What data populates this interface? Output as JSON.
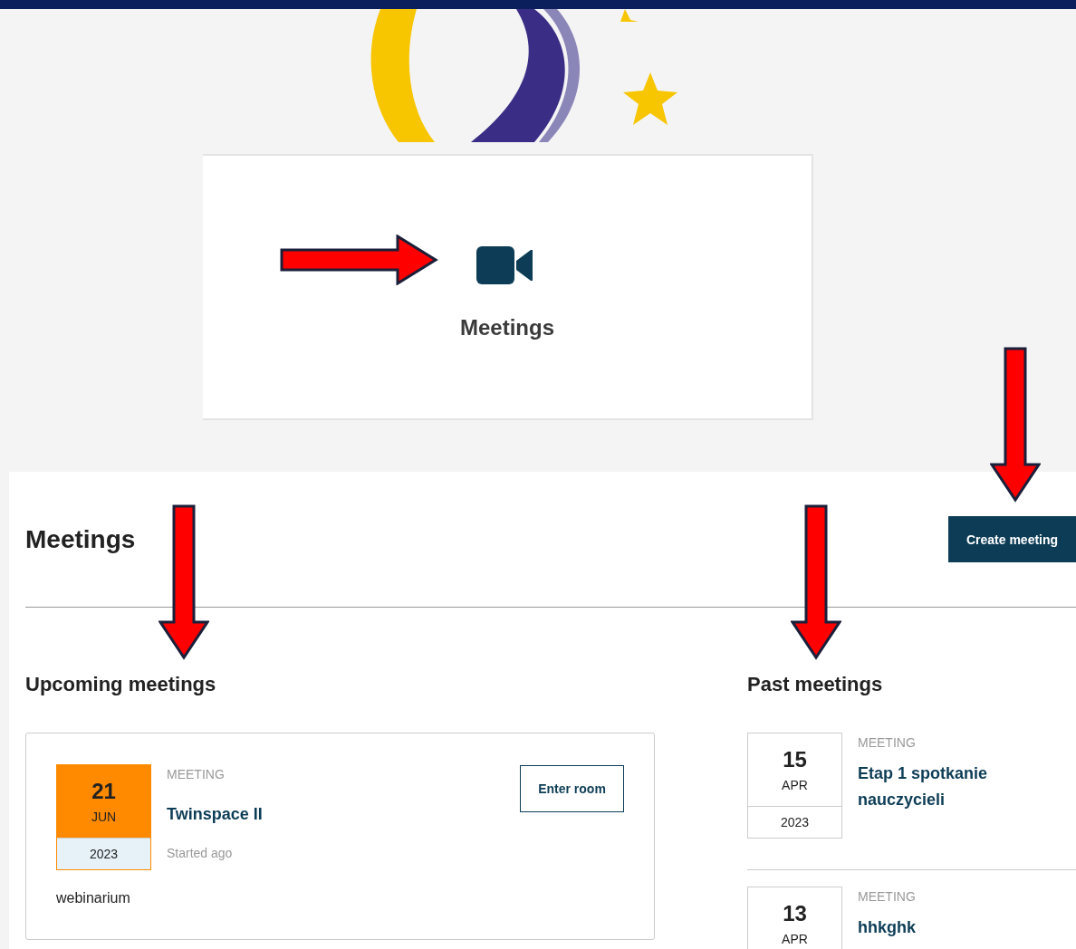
{
  "feature_tile": {
    "label": "Meetings"
  },
  "panel": {
    "title": "Meetings",
    "create_button": "Create meeting",
    "upcoming": {
      "heading": "Upcoming meetings",
      "items": [
        {
          "day": "21",
          "month": "JUN",
          "year": "2023",
          "type": "MEETING",
          "title": "Twinspace II",
          "status": "Started ago",
          "button": "Enter room",
          "description": "webinarium",
          "highlighted": true
        }
      ]
    },
    "past": {
      "heading": "Past meetings",
      "items": [
        {
          "day": "15",
          "month": "APR",
          "year": "2023",
          "type": "MEETING",
          "title": "Etap 1 spotkanie nauczycieli",
          "highlighted": false
        },
        {
          "day": "13",
          "month": "APR",
          "type": "MEETING",
          "title": "hhkghk",
          "highlighted": false
        }
      ]
    }
  }
}
